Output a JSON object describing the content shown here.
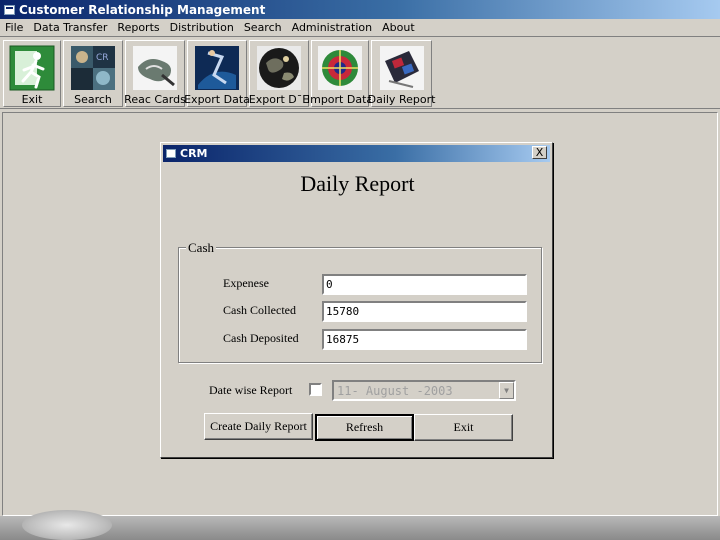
{
  "app": {
    "title": "Customer Relationship Management"
  },
  "menu": [
    "File",
    "Data Transfer",
    "Reports",
    "Distribution",
    "Search",
    "Administration",
    "About"
  ],
  "toolbar": {
    "exit": "Exit",
    "search": "Search",
    "reac_cards": "Reac Cards",
    "export_data": "Export Data",
    "export_dte": "Export D¯E",
    "import_data": "Import Data",
    "daily_report": "Daily Report"
  },
  "dialog": {
    "title": "CRM",
    "close": "X",
    "heading": "Daily Report",
    "cash_group": "Cash",
    "expenses_label": "Expenese",
    "expenses_value": "0",
    "cash_collected_label": "Cash Collected",
    "cash_collected_value": "15780",
    "cash_deposited_label": "Cash Deposited",
    "cash_deposited_value": "16875",
    "date_wise_label": "Date wise Report",
    "date_wise_checked": false,
    "date_value": "11-  August  -2003",
    "create_button": "Create Daily Report",
    "refresh_button": "Refresh",
    "exit_button": "Exit"
  }
}
